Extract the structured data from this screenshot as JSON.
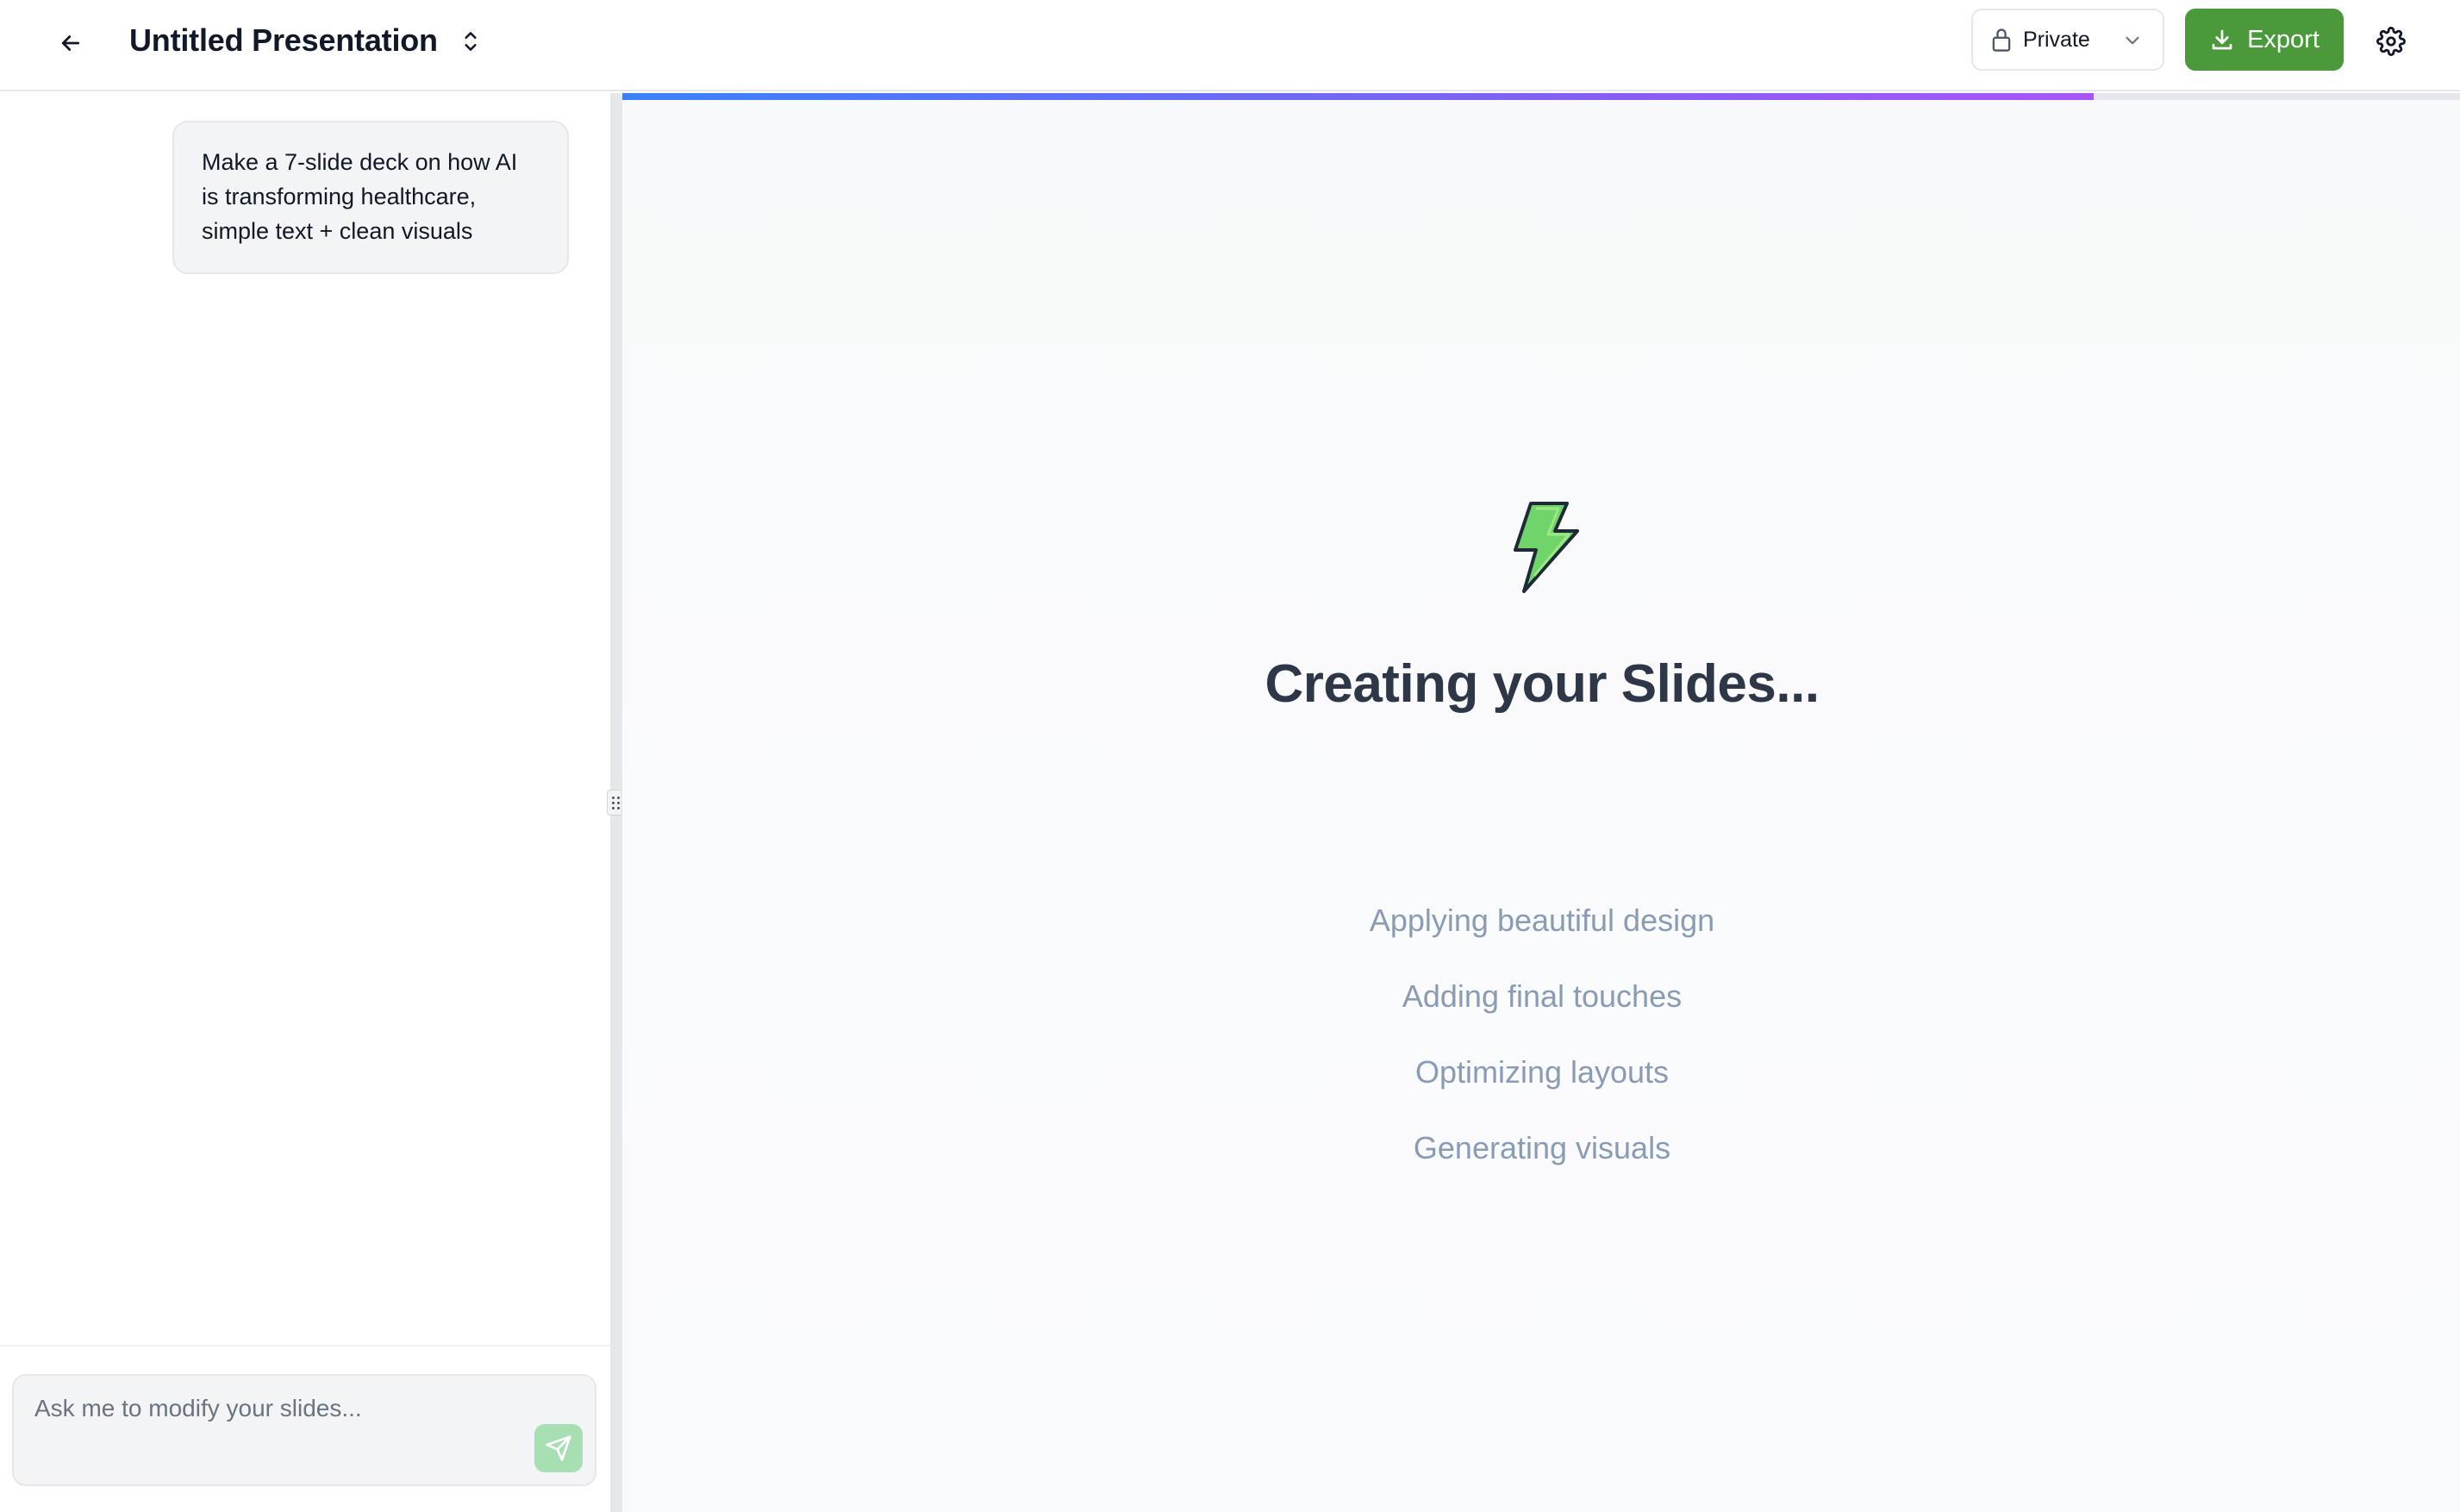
{
  "header": {
    "title": "Untitled Presentation",
    "privacy": {
      "selected": "Private"
    },
    "export_label": "Export"
  },
  "chat": {
    "messages": [
      {
        "role": "user",
        "text": "Make a 7-slide deck on how AI is transforming healthcare, simple text + clean visuals"
      }
    ],
    "composer": {
      "placeholder": "Ask me to modify your slides...",
      "value": ""
    }
  },
  "preview": {
    "progress_fraction": 0.8,
    "heading": "Creating your Slides...",
    "steps": [
      "Applying beautiful design",
      "Adding final touches",
      "Optimizing layouts",
      "Generating visuals"
    ]
  },
  "icons": {
    "back": "arrow-left-icon",
    "title_toggle": "chevron-up-down-icon",
    "lock": "lock-icon",
    "privacy_chevron": "chevron-down-icon",
    "export": "download-icon",
    "settings": "gear-icon",
    "send": "send-icon",
    "loader": "lightning-bolt-icon",
    "grip": "grip-icon"
  },
  "colors": {
    "export_bg": "#4a9a3c",
    "send_bg": "#a7dfb3",
    "progress_start": "#3b82f6",
    "progress_end": "#a855f7",
    "bolt_fill": "#6fd46a",
    "heading": "#2d3748",
    "steps": "#8a9bb4"
  }
}
